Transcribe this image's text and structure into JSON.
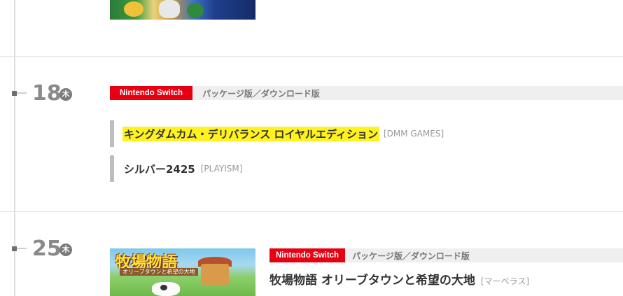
{
  "entries": [
    {
      "day": "18",
      "weekday": "木",
      "platform": "Nintendo Switch",
      "edition": "パッケージ版／ダウンロード版",
      "games": [
        {
          "title": "キングダムカム・デリバランス ロイヤルエディション",
          "publisher": "[DMM GAMES]",
          "highlighted": true
        },
        {
          "title": "シルバー2425",
          "publisher": "[PLAYISM]",
          "highlighted": false
        }
      ]
    },
    {
      "day": "25",
      "weekday": "木",
      "platform": "Nintendo Switch",
      "edition": "パッケージ版／ダウンロード版",
      "games": [
        {
          "title": "牧場物語 オリーブタウンと希望の大地",
          "publisher": "[マーベラス]"
        }
      ],
      "thumbnail": {
        "logo_text": "牧場物語",
        "subtitle_text": "オリーブタウンと希望の大地"
      }
    }
  ],
  "colors": {
    "platform_red": "#e60012",
    "highlight_yellow": "#fff21e",
    "date_gray": "#8a8a8a"
  }
}
